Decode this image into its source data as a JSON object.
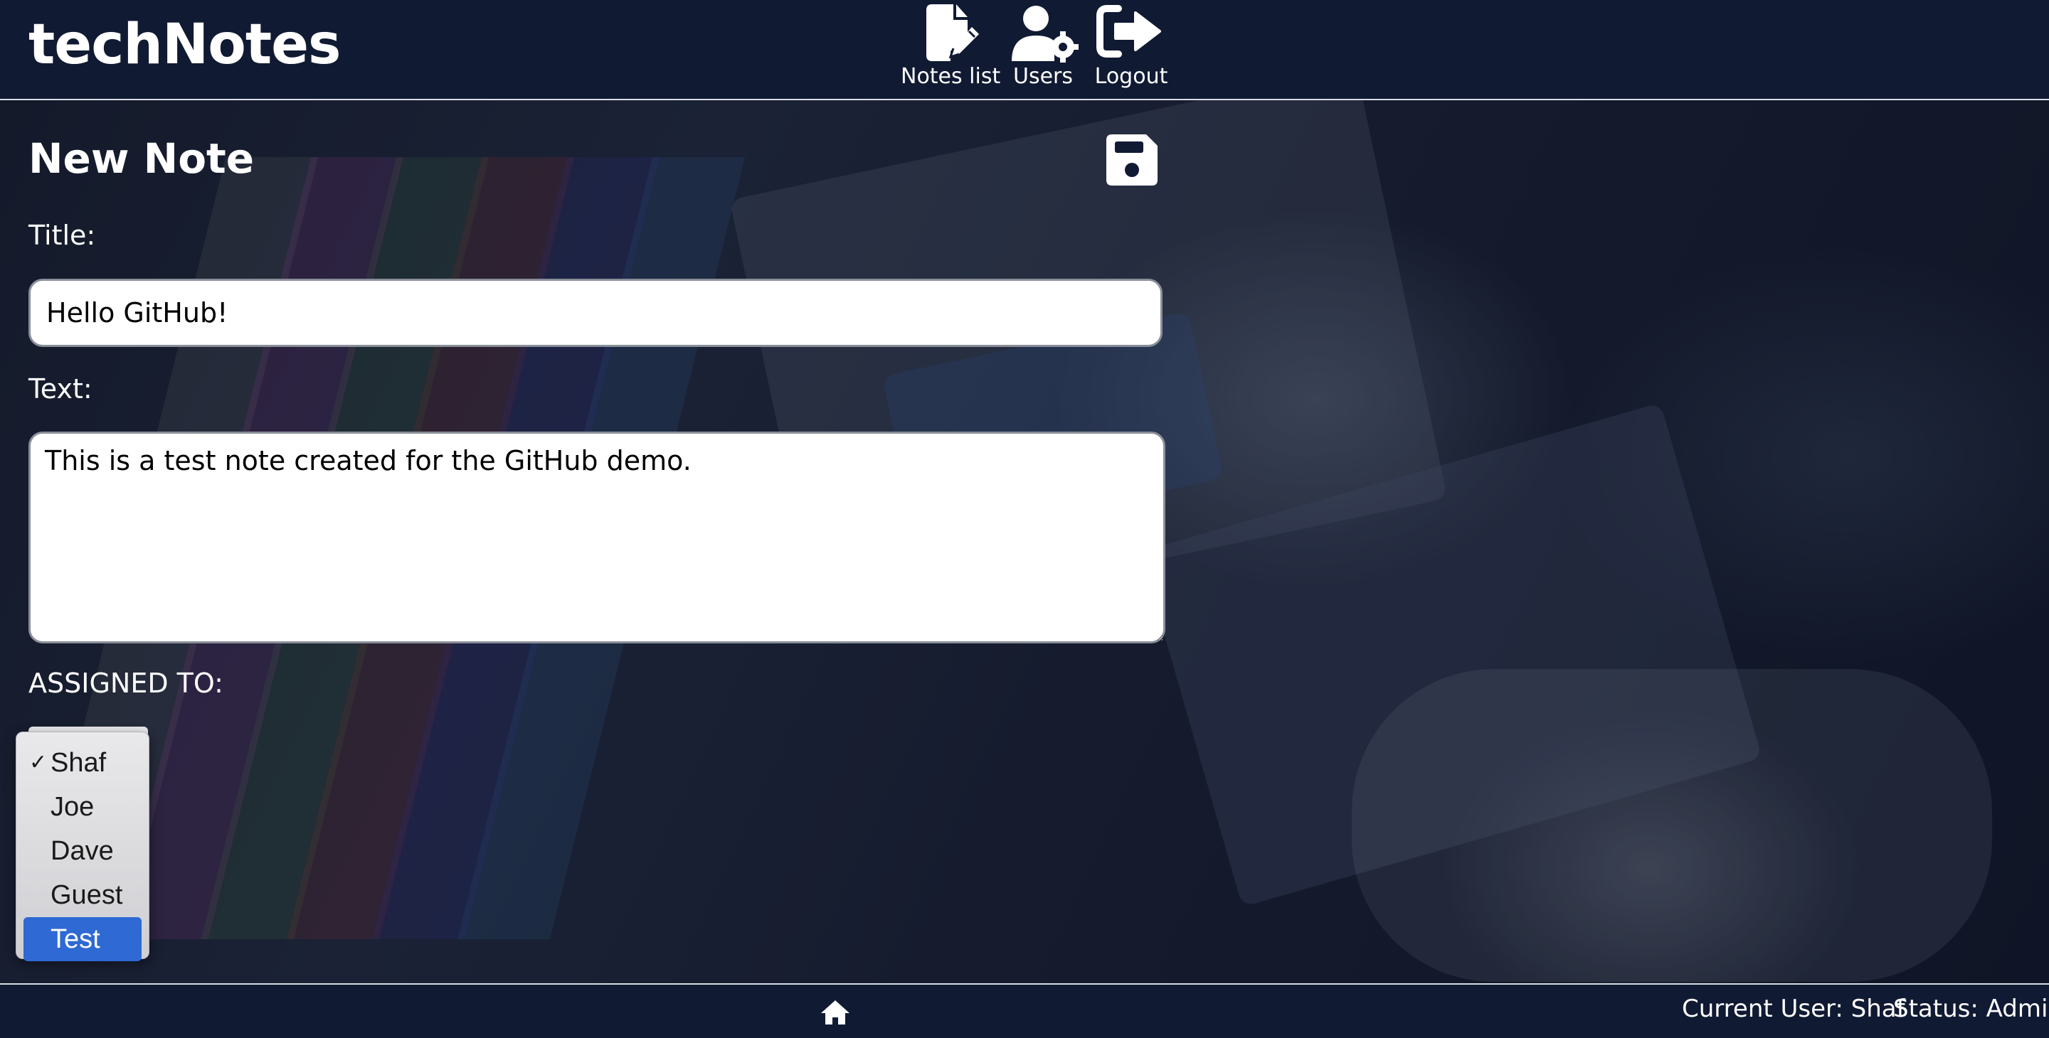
{
  "header": {
    "brand": "techNotes",
    "nav": [
      {
        "label": "Notes list",
        "icon": "file-pen-icon"
      },
      {
        "label": "Users",
        "icon": "user-gear-icon"
      },
      {
        "label": "Logout",
        "icon": "logout-icon"
      }
    ]
  },
  "form": {
    "heading": "New Note",
    "save_icon": "floppy-disk-icon",
    "title_label": "Title:",
    "title_value": "Hello GitHub!",
    "text_label": "Text:",
    "text_value": "This is a test note created for the GitHub demo.",
    "assigned_label": "ASSIGNED TO:",
    "assigned_options": [
      {
        "label": "Shaf",
        "checked": true,
        "highlighted": false
      },
      {
        "label": "Joe",
        "checked": false,
        "highlighted": false
      },
      {
        "label": "Dave",
        "checked": false,
        "highlighted": false
      },
      {
        "label": "Guest",
        "checked": false,
        "highlighted": false
      },
      {
        "label": "Test",
        "checked": false,
        "highlighted": true
      }
    ],
    "check_glyph": "✓"
  },
  "footer": {
    "home_icon": "home-icon",
    "current_user": "Current User: Shaf",
    "status": "Status: Admin"
  },
  "colors": {
    "header_bg": "#111a33",
    "highlight": "#2f69d3"
  }
}
